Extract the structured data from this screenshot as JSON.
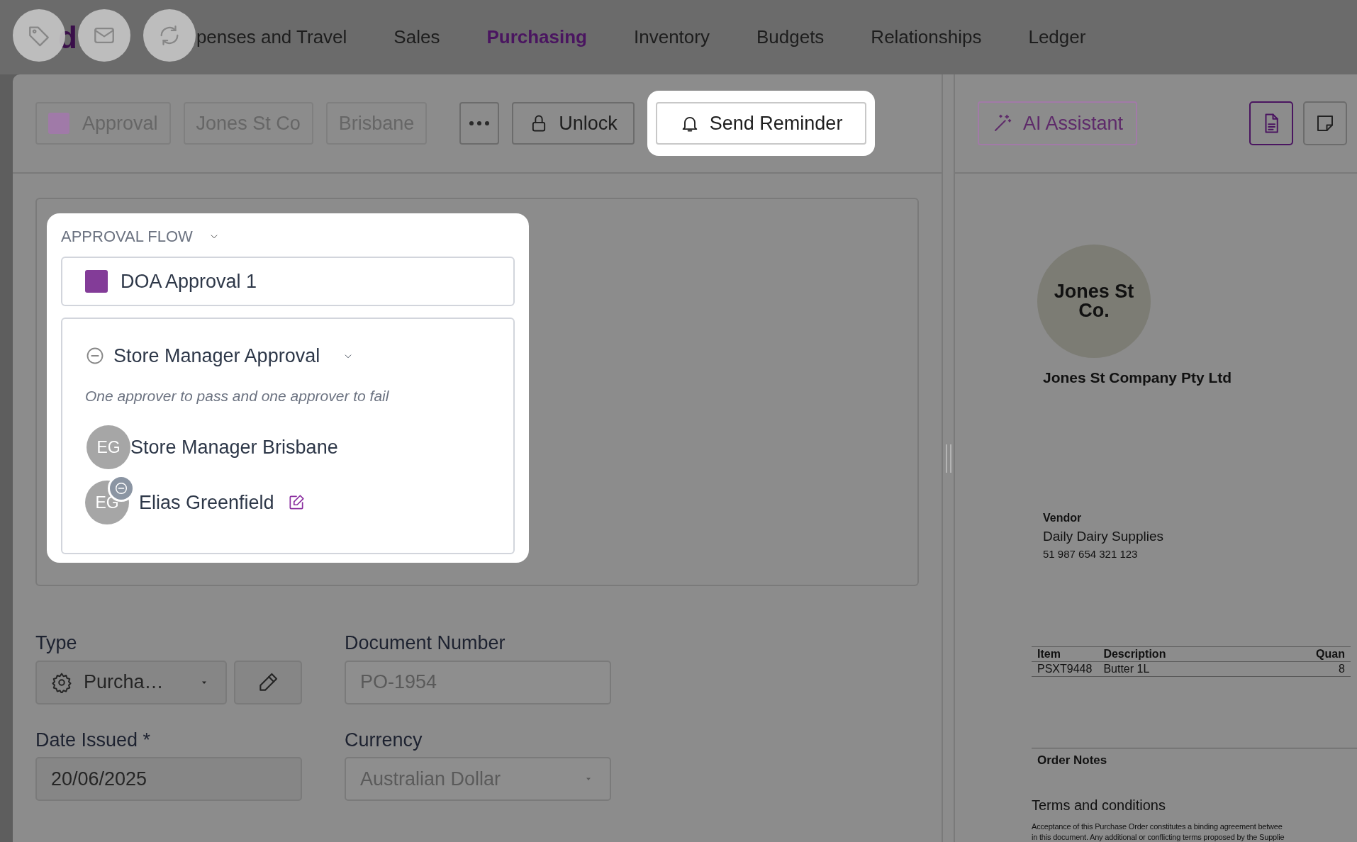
{
  "nav": {
    "logo": "d",
    "items": [
      {
        "label": "penses and Travel",
        "selected": false
      },
      {
        "label": "Sales",
        "selected": false
      },
      {
        "label": "Purchasing",
        "selected": true
      },
      {
        "label": "Inventory",
        "selected": false
      },
      {
        "label": "Budgets",
        "selected": false
      },
      {
        "label": "Relationships",
        "selected": false
      },
      {
        "label": "Ledger",
        "selected": false
      }
    ]
  },
  "toolbar": {
    "status_chip": {
      "label": "Approval",
      "color": "#a07aa8"
    },
    "chips": [
      "Jones St Co",
      "Brisbane"
    ],
    "unlock": "Unlock",
    "send_reminder": "Send Reminder"
  },
  "approval_flow": {
    "title": "APPROVAL FLOW",
    "expanded": true,
    "policy": {
      "label": "DOA Approval 1",
      "color": "#833c98"
    },
    "step": {
      "name": "Store Manager Approval",
      "expanded": true,
      "rule": "One approver to pass and one approver to fail",
      "approvers": [
        {
          "kind": "role",
          "initials": "EG",
          "name": "Store Manager Brisbane"
        },
        {
          "kind": "person",
          "initials": "EG",
          "name": "Elias Greenfield"
        }
      ]
    }
  },
  "form": {
    "fields": [
      {
        "kind": "type-select",
        "label": "Type",
        "value": "Purcha…"
      },
      {
        "kind": "text",
        "label": "Document Number",
        "value": "PO-1954",
        "disabled": true
      },
      {
        "kind": "text",
        "label": "Date Issued *",
        "value": "20/06/2025",
        "disabled": false
      },
      {
        "kind": "select",
        "label": "Currency",
        "value": "Australian Dollar",
        "disabled": true
      }
    ]
  },
  "side": {
    "assistant": "AI Assistant",
    "views": [
      {
        "kind": "document",
        "selected": true
      },
      {
        "kind": "note",
        "selected": false
      }
    ]
  },
  "document": {
    "logo": "Jones St Co.",
    "company": "Jones St Company Pty Ltd",
    "vendor_heading": "Vendor",
    "vendor_name": "Daily Dairy Supplies",
    "vendor_abn": "51 987 654 321 123",
    "table": {
      "columns": [
        "Item",
        "Description",
        "Quan"
      ],
      "rows": [
        [
          "PSXT9448",
          "Butter 1L",
          "8"
        ]
      ]
    },
    "notes_heading": "Order Notes",
    "terms_heading": "Terms and conditions",
    "terms_lines": [
      "Acceptance of this Purchase Order constitutes a binding agreement betwee",
      "in this document. Any additional or conflicting terms proposed by the Supplie"
    ]
  }
}
